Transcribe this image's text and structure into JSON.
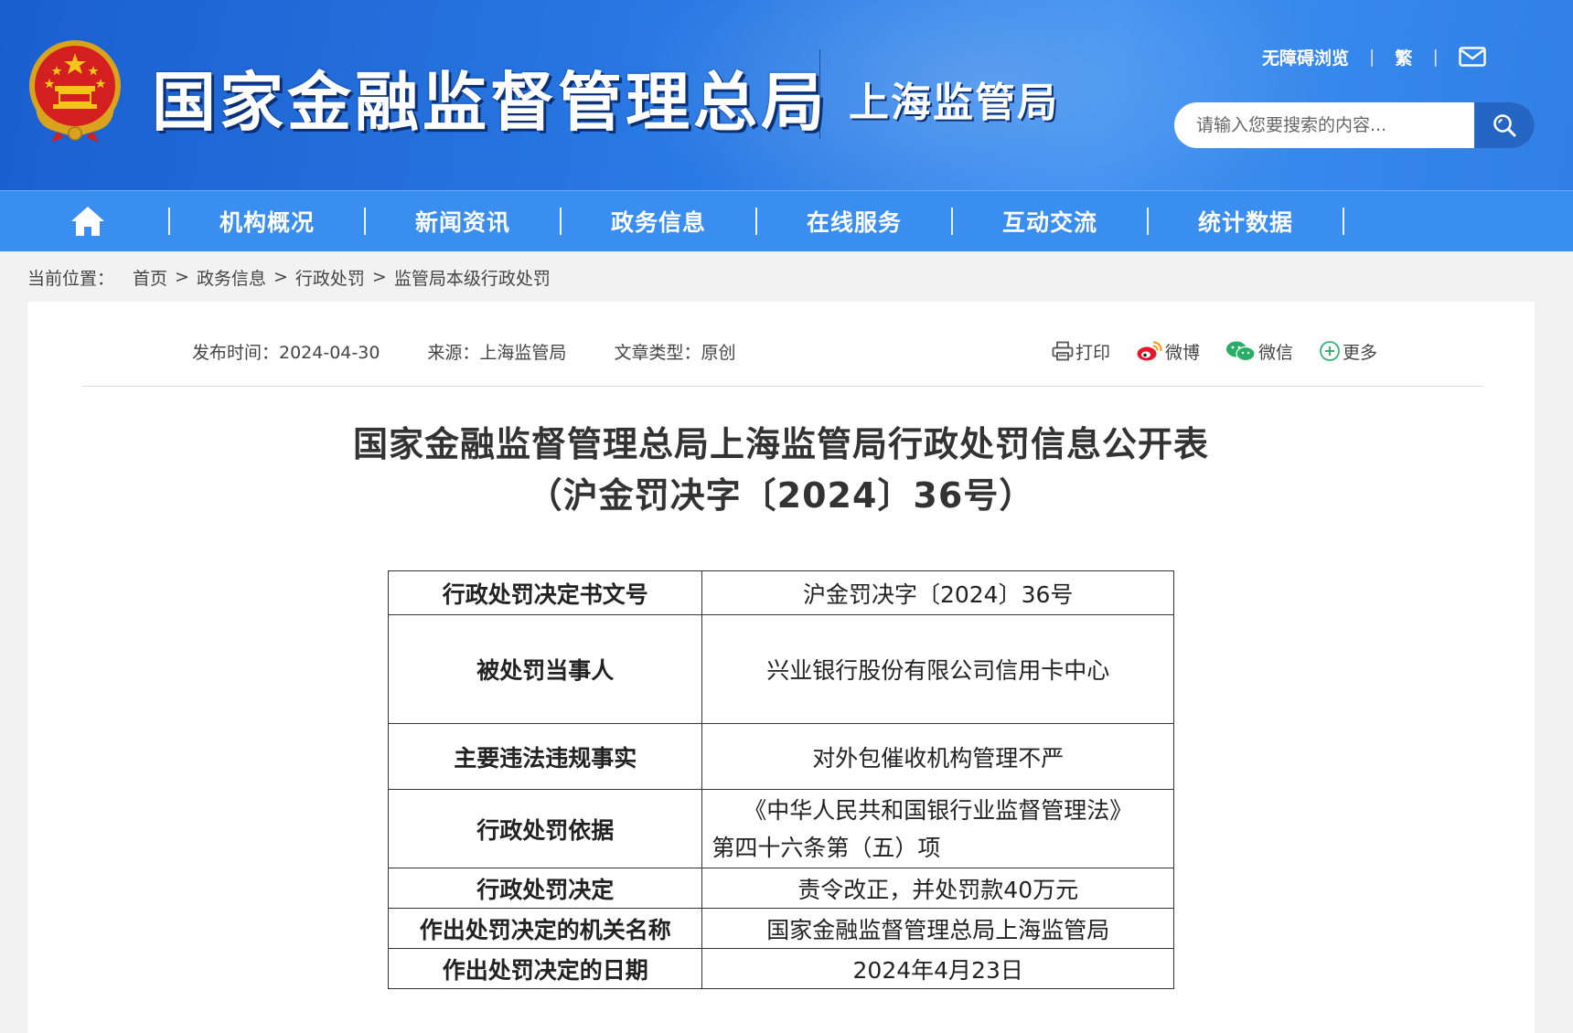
{
  "header": {
    "site_title": "国家金融监督管理总局",
    "sub_title": "上海监管局",
    "links": [
      "无障碍浏览",
      "繁"
    ],
    "search_placeholder": "请输入您要搜索的内容..."
  },
  "nav": {
    "items": [
      "机构概况",
      "新闻资讯",
      "政务信息",
      "在线服务",
      "互动交流",
      "统计数据"
    ]
  },
  "breadcrumb": {
    "label": "当前位置：",
    "items": [
      "首页",
      "政务信息",
      "行政处罚",
      "监管局本级行政处罚"
    ],
    "sep": ">"
  },
  "meta": {
    "publish": "发布时间：2024-04-30",
    "source": "来源：上海监管局",
    "type": "文章类型：原创"
  },
  "share": {
    "print": "打印",
    "weibo": "微博",
    "wechat": "微信",
    "more": "更多"
  },
  "doc": {
    "title_line1": "国家金融监督管理总局上海监管局行政处罚信息公开表",
    "title_line2": "（沪金罚决字〔2024〕36号）"
  },
  "table": {
    "rows": [
      {
        "key": "行政处罚决定书文号",
        "value": "沪金罚决字〔2024〕36号"
      },
      {
        "key": "被处罚当事人",
        "value": "兴业银行股份有限公司信用卡中心"
      },
      {
        "key": "主要违法违规事实",
        "value": "对外包催收机构管理不严"
      },
      {
        "key": "行政处罚依据",
        "value_line1": "《中华人民共和国银行业监督管理法》",
        "value_line2": "第四十六条第（五）项"
      },
      {
        "key": "行政处罚决定",
        "value": "责令改正，并处罚款40万元"
      },
      {
        "key": "作出处罚决定的机关名称",
        "value": "国家金融监督管理总局上海监管局"
      },
      {
        "key": "作出处罚决定的日期",
        "value": "2024年4月23日"
      }
    ]
  }
}
